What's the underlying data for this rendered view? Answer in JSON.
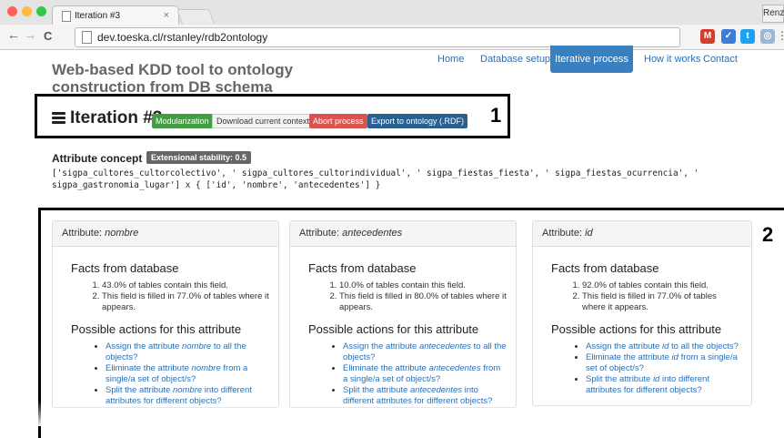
{
  "browser": {
    "tab_title": "Iteration #3",
    "tab_close": "×",
    "profile": "Renz",
    "url": "dev.toeska.cl/rstanley/rdb2ontology",
    "back": "←",
    "forward": "→",
    "reload": "C",
    "menu": "⋮"
  },
  "site": {
    "title": "Web-based KDD tool to ontology construction from DB schema",
    "nav": [
      "Home",
      "Database setup",
      "Iterative process",
      "How it works",
      "Contact"
    ]
  },
  "iteration": {
    "title": "Iteration #3",
    "badge": "Modularization",
    "buttons": {
      "download": "Download current context",
      "abort": "Abort process",
      "export": "Export to ontology (.RDF)"
    }
  },
  "callouts": {
    "one": "1",
    "two": "2"
  },
  "concept": {
    "label": "Attribute concept",
    "stability": "Extensional stability: 0.5",
    "code": "['sigpa_cultores_cultorcolectivo', ' sigpa_cultores_cultorindividual', ' sigpa_fiestas_fiesta', ' sigpa_fiestas_ocurrencia', '\nsigpa_gastronomia_lugar'] x { ['id', 'nombre', 'antecedentes'] }"
  },
  "panels": [
    {
      "head_prefix": "Attribute: ",
      "attr": "nombre",
      "facts_title": "Facts from database",
      "facts": [
        "43.0% of tables contain this field.",
        "This field is filled in 77.0% of tables where it appears."
      ],
      "actions_title": "Possible actions for this attribute",
      "actions": [
        [
          "Assign the attribute ",
          "nombre",
          " to all the objects?"
        ],
        [
          "Eliminate the attribute ",
          "nombre",
          " from a single/a set of object/s?"
        ],
        [
          "Split the attribute ",
          "nombre",
          " into different attributes for different objects?"
        ]
      ]
    },
    {
      "head_prefix": "Attribute: ",
      "attr": "antecedentes",
      "facts_title": "Facts from database",
      "facts": [
        "10.0% of tables contain this field.",
        "This field is filled in 80.0% of tables where it appears."
      ],
      "actions_title": "Possible actions for this attribute",
      "actions": [
        [
          "Assign the attribute ",
          "antecedentes",
          " to all the objects?"
        ],
        [
          "Eliminate the attribute ",
          "antecedentes",
          " from a single/a set of object/s?"
        ],
        [
          "Split the attribute ",
          "antecedentes",
          " into different attributes for different objects?"
        ]
      ]
    },
    {
      "head_prefix": "Attribute: ",
      "attr": "id",
      "facts_title": "Facts from database",
      "facts": [
        "92.0% of tables contain this field.",
        "This field is filled in 77.0% of tables where it appears."
      ],
      "actions_title": "Possible actions for this attribute",
      "actions": [
        [
          "Assign the attribute ",
          "id",
          " to all the objects?"
        ],
        [
          "Eliminate the attribute ",
          "id",
          " from a single/a set of object/s?"
        ],
        [
          "Split the attribute ",
          "id",
          " into different attributes for different objects?"
        ]
      ]
    }
  ],
  "colors": {
    "primary": "#3a7fbf",
    "success": "#449d44",
    "danger": "#d9534f",
    "link": "#2a6fb5",
    "label_gray": "#666666"
  },
  "icons": [
    "tasks-icon",
    "page-icon",
    "gmail-icon",
    "extension-icon",
    "twitter-icon",
    "camera-icon"
  ]
}
